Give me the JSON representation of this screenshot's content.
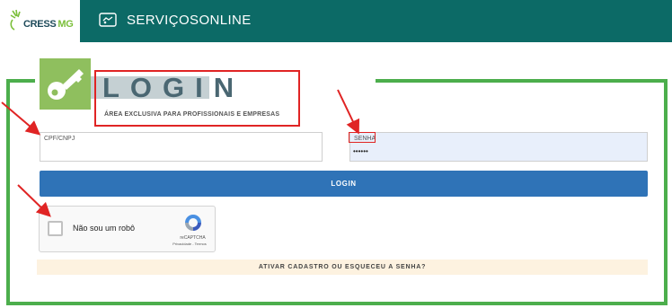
{
  "header": {
    "brand_name": "CRESS",
    "brand_region": "MG",
    "service_title": "SERVIÇOSONLINE"
  },
  "login": {
    "title": "LOGIN",
    "subtitle": "ÁREA EXCLUSIVA PARA PROFISSIONAIS E EMPRESAS",
    "cpf_label": "CPF/CNPJ",
    "cpf_value": "",
    "senha_label": "SENHA",
    "senha_value": "••••••",
    "button_label": "LOGIN",
    "activate_link": "ATIVAR CADASTRO OU ESQUECEU A SENHA?"
  },
  "recaptcha": {
    "label": "Não sou um robô",
    "brand": "reCAPTCHA",
    "links": "Privacidade - Termos"
  },
  "colors": {
    "header_teal": "#0c6a66",
    "frame_green": "#4cae4c",
    "button_blue": "#2f73b7",
    "annotation_red": "#e02424"
  },
  "icons": [
    "brand-leaf-icon",
    "key-icon",
    "services-icon",
    "recaptcha-icon",
    "annotation-arrow-icon"
  ]
}
